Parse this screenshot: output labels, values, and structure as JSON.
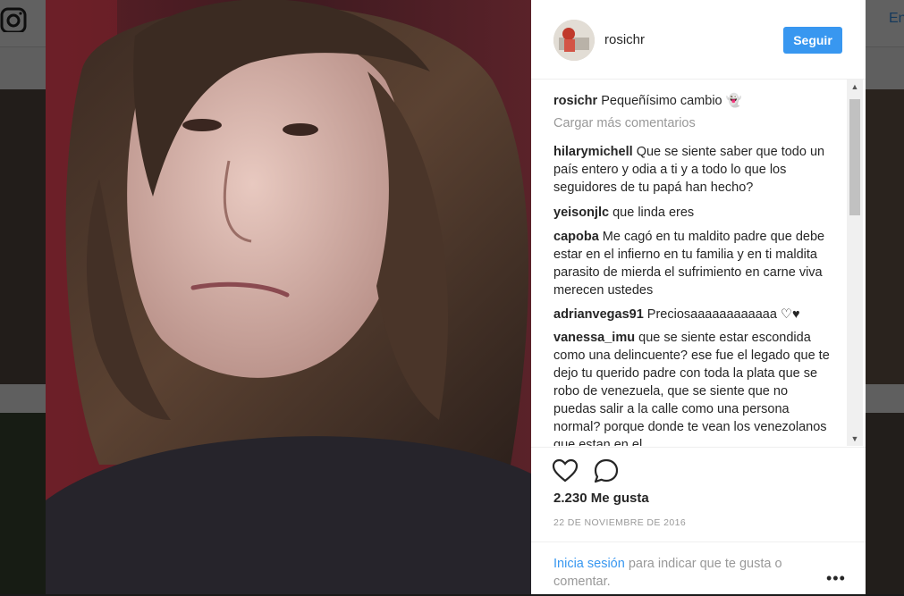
{
  "background": {
    "right_link_text": "En"
  },
  "post": {
    "username": "rosichr",
    "follow_label": "Seguir",
    "caption": {
      "username": "rosichr",
      "text": "Pequeñísimo cambio 👻"
    },
    "load_more_label": "Cargar más comentarios",
    "comments": [
      {
        "username": "hilarymichell",
        "text": "Que se siente saber que todo un país entero y odia a ti y a todo lo que los seguidores de tu papá han hecho?"
      },
      {
        "username": "yeisonjlc",
        "text": "que linda eres"
      },
      {
        "username": "capoba",
        "text": "Me cagó en tu maldito padre que debe estar en el infierno en tu familia y en ti maldita parasito de mierda el sufrimiento en carne viva merecen ustedes"
      },
      {
        "username": "adrianvegas91",
        "text": "Preciosaaaaaaaaaaaa ♡♥"
      },
      {
        "username": "vanessa_imu",
        "text": "que se siente estar escondida como una delincuente? ese fue el legado que te dejo tu querido padre con toda la plata que se robo de venezuela, que se siente que no puedas salir a la calle como una persona normal? porque donde te vean los venezolanos que estan en el"
      }
    ],
    "likes_label": "2.230 Me gusta",
    "date_label": "22 DE NOVIEMBRE DE 2016",
    "login_prompt": {
      "link_text": "Inicia sesión",
      "rest_text": " para indicar que te gusta o comentar."
    },
    "more_options_label": "•••"
  },
  "colors": {
    "accent": "#3897f0",
    "text": "#262626",
    "muted": "#999999"
  },
  "icons": {
    "like": "heart-icon",
    "comment": "comment-icon",
    "logo": "instagram-logo-icon"
  }
}
